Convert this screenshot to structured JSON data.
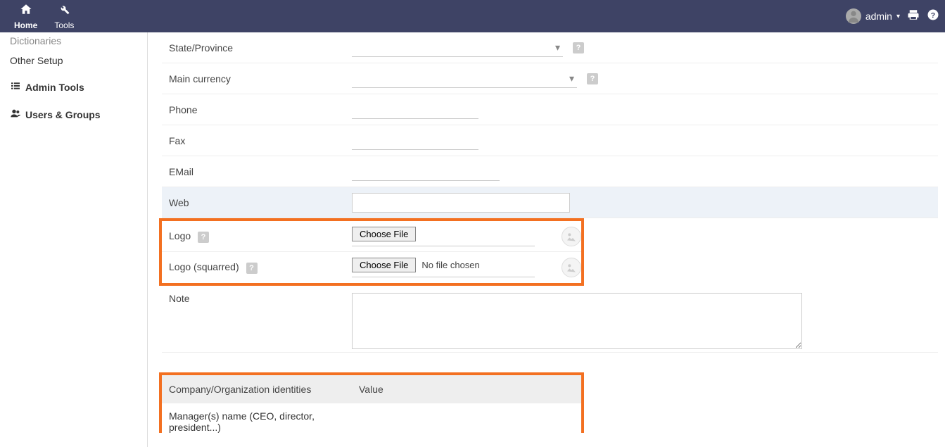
{
  "navbar": {
    "home": "Home",
    "tools": "Tools",
    "username": "admin"
  },
  "sidebar": {
    "dictionaries": "Dictionaries",
    "other_setup": "Other Setup",
    "admin_tools": "Admin Tools",
    "users_groups": "Users & Groups"
  },
  "form": {
    "state_label": "State/Province",
    "currency_label": "Main currency",
    "phone_label": "Phone",
    "fax_label": "Fax",
    "email_label": "EMail",
    "web_label": "Web",
    "logo_label": "Logo",
    "logo_squared_label": "Logo (squarred)",
    "note_label": "Note",
    "choose_file": "Choose File",
    "no_file": "No file chosen",
    "help": "?"
  },
  "identities": {
    "col1": "Company/Organization identities",
    "col2": "Value",
    "row1": "Manager(s) name (CEO, director, president...)"
  }
}
